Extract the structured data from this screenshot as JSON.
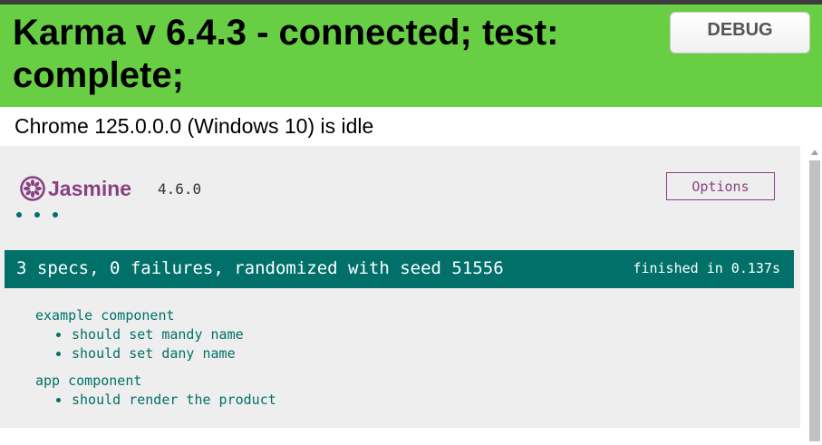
{
  "banner": {
    "title": "Karma v 6.4.3 - connected; test: complete;",
    "debug_label": "DEBUG"
  },
  "browser_status": "Chrome 125.0.0.0 (Windows 10) is idle",
  "jasmine": {
    "logo_text": "Jasmine",
    "version": "4.6.0",
    "options_label": "Options"
  },
  "summary": {
    "text": "3 specs, 0 failures, randomized with seed 51556",
    "duration": "finished in 0.137s"
  },
  "suites": [
    {
      "name": "example component",
      "specs": [
        "should set mandy name",
        "should set dany name"
      ]
    },
    {
      "name": "app component",
      "specs": [
        "should render the product"
      ]
    }
  ],
  "colors": {
    "banner": "#68cf44",
    "jasmine_purple": "#8a4182",
    "passed_teal": "#007069",
    "frame_bg": "#eeeeee"
  }
}
